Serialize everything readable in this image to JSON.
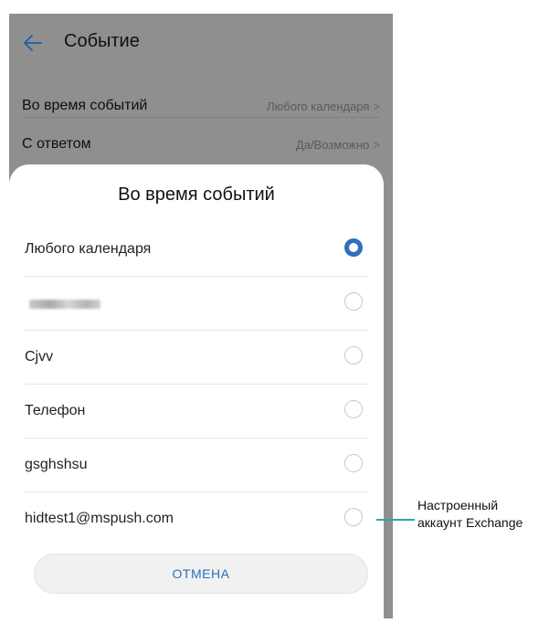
{
  "header": {
    "title": "Событие"
  },
  "settings": [
    {
      "label": "Во время событий",
      "value": "Любого календаря",
      "chevron": ">"
    },
    {
      "label": "С ответом",
      "value": "Да/Возможно",
      "chevron": ">"
    }
  ],
  "dialog": {
    "title": "Во время событий",
    "options": [
      {
        "label": "Любого календаря",
        "selected": true
      },
      {
        "label": "",
        "selected": false
      },
      {
        "label": "Cjvv",
        "selected": false
      },
      {
        "label": "Телефон",
        "selected": false
      },
      {
        "label": "gsghshsu",
        "selected": false
      },
      {
        "label": "hidtest1@mspush.com",
        "selected": false
      }
    ],
    "cancel_label": "ОТМЕНА"
  },
  "callout": {
    "line1": "Настроенный",
    "line2": "аккаунт Exchange"
  },
  "colors": {
    "accent": "#2f6fbd",
    "callout_line": "#2aa7a5",
    "dim_background": "#8f8f8f"
  },
  "icons": {
    "back": "arrow-left-icon",
    "row_chevron": "chevron-right-icon",
    "option_radio": "radio-icon"
  }
}
